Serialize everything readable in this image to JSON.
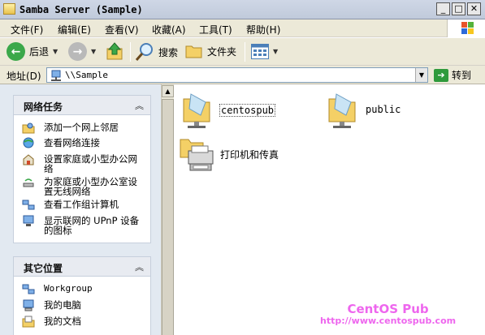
{
  "window": {
    "title": "Samba Server (Sample)"
  },
  "menu": [
    {
      "label": "文件(F)"
    },
    {
      "label": "编辑(E)"
    },
    {
      "label": "查看(V)"
    },
    {
      "label": "收藏(A)"
    },
    {
      "label": "工具(T)"
    },
    {
      "label": "帮助(H)"
    }
  ],
  "toolbar": {
    "back_label": "后退",
    "search_label": "搜索",
    "folders_label": "文件夹"
  },
  "address": {
    "label": "地址(D)",
    "value": "\\\\Sample",
    "go_label": "转到"
  },
  "network_tasks": {
    "title": "网络任务",
    "items": [
      {
        "label": "添加一个网上邻居",
        "icon": "add-network-place-icon"
      },
      {
        "label": "查看网络连接",
        "icon": "network-connections-icon"
      },
      {
        "label": "设置家庭或小型办公网络",
        "icon": "home-network-icon"
      },
      {
        "label": "为家庭或小型办公室设置无线网络",
        "icon": "wireless-network-icon"
      },
      {
        "label": "查看工作组计算机",
        "icon": "workgroup-computers-icon"
      },
      {
        "label": "显示联网的 UPnP 设备的图标",
        "icon": "upnp-devices-icon"
      }
    ]
  },
  "other_places": {
    "title": "其它位置",
    "items": [
      {
        "label": "Workgroup",
        "icon": "workgroup-icon"
      },
      {
        "label": "我的电脑",
        "icon": "my-computer-icon"
      },
      {
        "label": "我的文档",
        "icon": "my-documents-icon"
      }
    ]
  },
  "shares": [
    {
      "label": "centospub",
      "icon": "shared-folder-icon",
      "selected": true
    },
    {
      "label": "public",
      "icon": "shared-folder-icon",
      "selected": false
    },
    {
      "label": "打印机和传真",
      "icon": "printers-faxes-icon",
      "selected": false
    }
  ],
  "watermark": {
    "line1": "CentOS Pub",
    "line2": "http://www.centospub.com"
  },
  "colors": {
    "title_bar": "#c0cadb",
    "chrome": "#ece9d8",
    "task_pane": "#e2e9f1",
    "watermark": "#ee66ee",
    "go_green": "#2f9a3c"
  }
}
